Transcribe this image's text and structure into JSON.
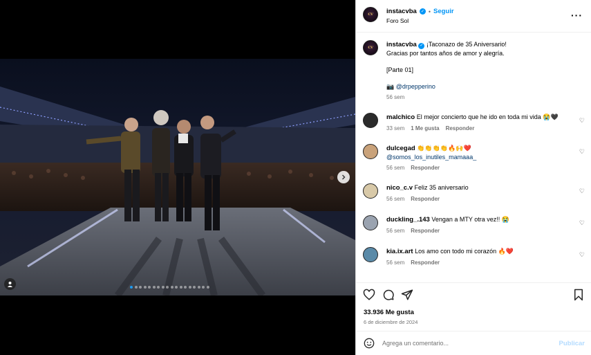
{
  "post": {
    "username": "instacvba",
    "follow_label": "Seguir",
    "location": "Foro Sol",
    "caption_line1": "¡Taconazo de 35 Aniversario!",
    "caption_line2": "Gracias por tantos años de amor y alegría.",
    "caption_line3": "[Parte 01]",
    "caption_credit": "@drpepperino",
    "caption_age": "56 sem",
    "likes": "33.936 Me gusta",
    "date": "6 de diciembre de 2024"
  },
  "comments": [
    {
      "user": "malchico",
      "text": "El mejor concierto que he ido en toda mi vida 😭🖤",
      "age": "33 sem",
      "likes": "1 Me gusta",
      "reply": "Responder",
      "avatar_color": "#2b2b2b"
    },
    {
      "user": "dulcegad",
      "text": "👏👏👏👏🔥🙌❤️",
      "mention": "@somos_los_inutiles_mamaaa_",
      "age": "56 sem",
      "reply": "Responder",
      "avatar_color": "#c9a27a"
    },
    {
      "user": "nico_c.v",
      "text": "Feliz 35 aniversario",
      "age": "56 sem",
      "reply": "Responder",
      "avatar_color": "#d8c9a8"
    },
    {
      "user": "duckling_.143",
      "text": "Vengan a MTY otra vez!! 😭",
      "age": "56 sem",
      "reply": "Responder",
      "avatar_color": "#9aa3b0"
    },
    {
      "user": "kia.ix.art",
      "text": "Los amo con todo mi corazón 🔥❤️",
      "age": "56 sem",
      "reply": "Responder",
      "avatar_color": "#5a8aa8"
    }
  ],
  "composer": {
    "placeholder": "Agrega un comentario...",
    "post_label": "Publicar"
  },
  "carousel": {
    "count": 18,
    "active": 0
  },
  "colors": {
    "accent": "#0095f6",
    "post_disabled": "#b3dbff",
    "muted": "#737373"
  },
  "icons": [
    "more-options-icon",
    "heart-icon",
    "comment-icon",
    "share-icon",
    "save-icon",
    "emoji-icon",
    "next-arrow-icon",
    "user-tag-icon",
    "verified-icon",
    "camera-icon"
  ]
}
